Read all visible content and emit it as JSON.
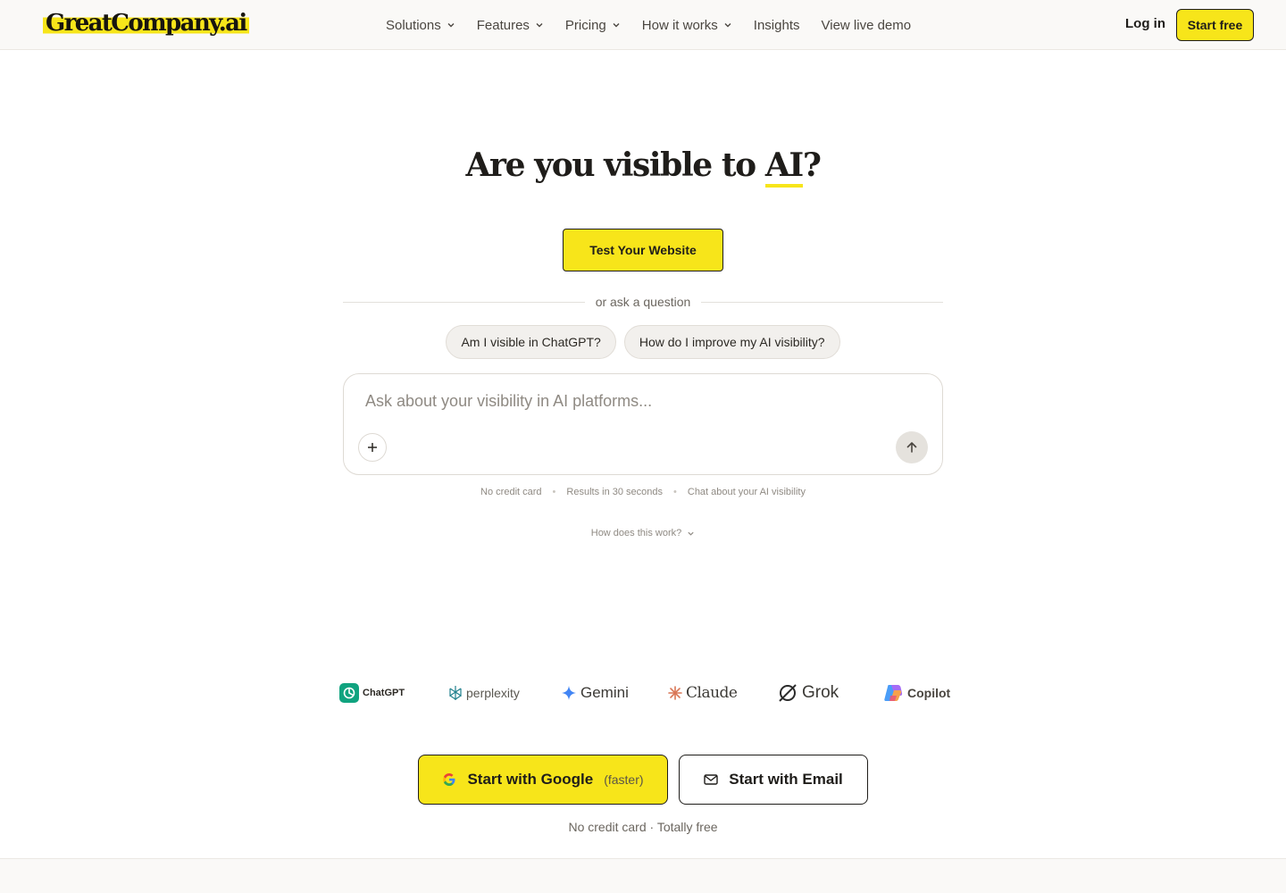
{
  "brand": {
    "logo_text": "GreatCompany.ai",
    "accent_color": "#f7e51a"
  },
  "nav": {
    "items": [
      {
        "label": "Solutions",
        "has_dropdown": true
      },
      {
        "label": "Features",
        "has_dropdown": true
      },
      {
        "label": "Pricing",
        "has_dropdown": true
      },
      {
        "label": "How it works",
        "has_dropdown": true
      },
      {
        "label": "Insights",
        "has_dropdown": false
      },
      {
        "label": "View live demo",
        "has_dropdown": false
      }
    ],
    "login_label": "Log in",
    "start_free_label": "Start free"
  },
  "hero": {
    "title_prefix": "Are you visible to ",
    "title_accent": "AI",
    "title_suffix": "?",
    "test_button_label": "Test Your Website",
    "divider_text": "or ask a question",
    "suggestions": [
      "Am I visible in ChatGPT?",
      "How do I improve my AI visibility?"
    ],
    "ask_placeholder": "Ask about your visibility in AI platforms...",
    "ask_value": "",
    "perks": [
      "No credit card",
      "Results in 30 seconds",
      "Chat about your AI visibility"
    ],
    "how_works_label": "How does this work?"
  },
  "platforms": [
    {
      "name": "ChatGPT",
      "icon": "chatgpt-icon",
      "color": "#10a37f"
    },
    {
      "name": "perplexity",
      "icon": "perplexity-icon",
      "color": "#20808d"
    },
    {
      "name": "Gemini",
      "icon": "gemini-icon",
      "color": "#4285f4"
    },
    {
      "name": "Claude",
      "icon": "claude-icon",
      "color": "#d97757"
    },
    {
      "name": "Grok",
      "icon": "grok-icon",
      "color": "#2b2b2b"
    },
    {
      "name": "Copilot",
      "icon": "copilot-icon",
      "color": "#7b61ff"
    }
  ],
  "cta": {
    "google_label": "Start with Google",
    "google_note": "(faster)",
    "email_label": "Start with Email",
    "note": "No credit card · Totally free"
  }
}
